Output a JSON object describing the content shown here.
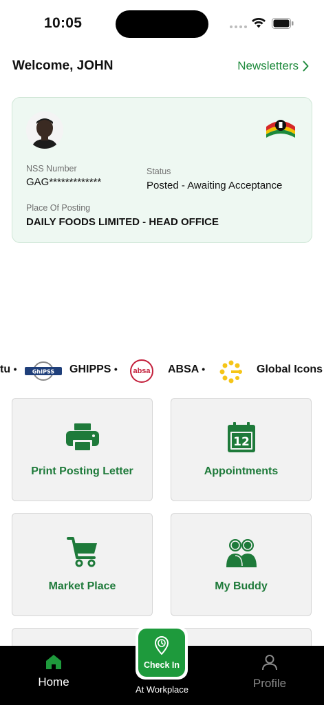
{
  "status_bar": {
    "time": "10:05"
  },
  "header": {
    "welcome": "Welcome, JOHN",
    "newsletters_label": "Newsletters"
  },
  "card": {
    "nss_label": "NSS Number",
    "nss_value": "GAG*************",
    "status_label": "Status",
    "status_value": "Posted - Awaiting Acceptance",
    "posting_label": "Place Of Posting",
    "posting_value": "DAILY FOODS LIMITED - HEAD OFFICE"
  },
  "sponsors": {
    "partial": "tu",
    "ghipss_logo_text": "GhIPSS",
    "ghipss": "GHIPPS",
    "absa_logo_text": "absa",
    "absa": "ABSA",
    "global": "Global Icons",
    "separator": "•"
  },
  "tiles": [
    {
      "label": "Print Posting Letter",
      "icon": "printer-icon"
    },
    {
      "label": "Appointments",
      "icon": "calendar-icon",
      "calendar_day": "12"
    },
    {
      "label": "Market Place",
      "icon": "cart-icon"
    },
    {
      "label": "My Buddy",
      "icon": "buddy-icon"
    }
  ],
  "bottom_nav": {
    "home": "Home",
    "checkin": "Check In",
    "checkin_caption": "At Workplace",
    "profile": "Profile"
  },
  "colors": {
    "accent_green": "#1e8a3c",
    "card_bg": "#eef8f2",
    "nav_bg": "#000000"
  }
}
